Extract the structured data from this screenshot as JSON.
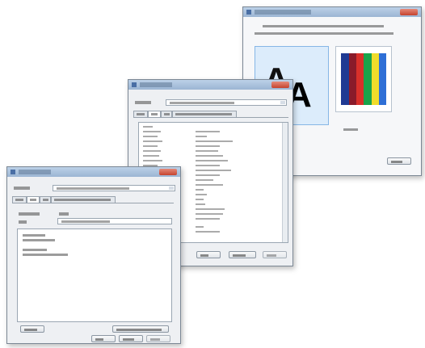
{
  "icons": {
    "close": "close-icon",
    "system_menu": "window-icon",
    "dropdown": "chevron-down-icon",
    "font_sample_glyph": "A"
  },
  "colors": {
    "titlebar": "#9bb5d3",
    "close_button": "#c5432e",
    "window_bg": "#eef0f3",
    "selection": "#dcecfb",
    "color_bars": [
      "#1f3a93",
      "#8a1b2a",
      "#d9302a",
      "#1aa34a",
      "#f0dc2a",
      "#2e6fd6"
    ]
  }
}
